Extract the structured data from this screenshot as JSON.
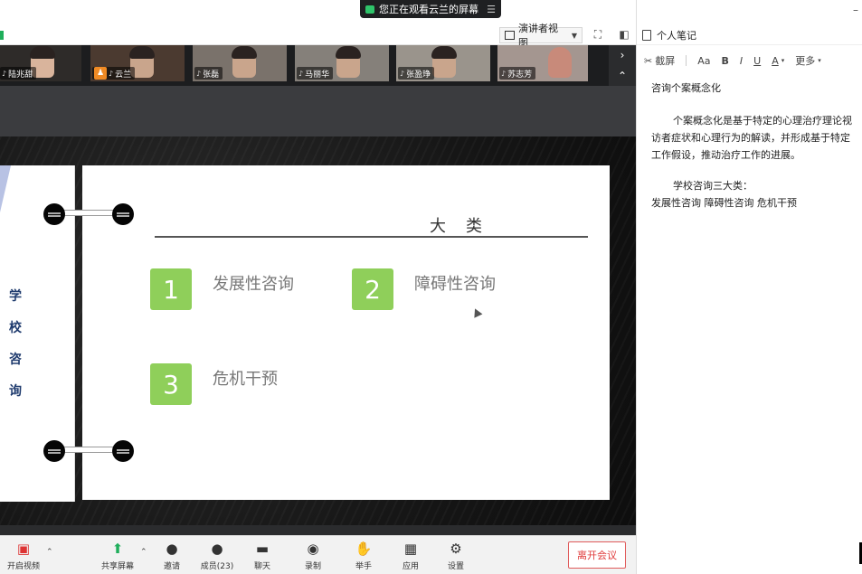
{
  "share_banner": {
    "text": "您正在观看云兰的屏幕",
    "menu_icon": "menu-icon"
  },
  "view_bar": {
    "presenter_view_label": "演讲者视图"
  },
  "participants": [
    {
      "name": "陆兆甜"
    },
    {
      "name": "云兰",
      "is_host": true
    },
    {
      "name": "张磊"
    },
    {
      "name": "马丽华"
    },
    {
      "name": "张盈琤"
    },
    {
      "name": "苏志芳"
    }
  ],
  "slide": {
    "side_title": [
      "学",
      "校",
      "咨",
      "询"
    ],
    "title": "大类",
    "items": [
      {
        "num": "1",
        "label": "发展性咨询"
      },
      {
        "num": "2",
        "label": "障碍性咨询"
      },
      {
        "num": "3",
        "label": "危机干预"
      }
    ],
    "accent_color": "#8fcf5a"
  },
  "toolbar": {
    "video": "开启视频",
    "share": "共享屏幕",
    "invite": "邀请",
    "members": "成员(23)",
    "chat": "聊天",
    "record": "录制",
    "raise_hand": "举手",
    "apps": "应用",
    "settings": "设置",
    "leave": "离开会议"
  },
  "notes": {
    "header": "个人笔记",
    "format": {
      "screenshot": "截屏",
      "font_size": "Aa",
      "bold": "B",
      "italic": "I",
      "underline": "U",
      "color": "A",
      "more": "更多"
    },
    "title": "咨询个案概念化",
    "para1_line1": "个案概念化是基于特定的心理治疗理论视",
    "para1_line2": "访者症状和心理行为的解读，并形成基于特定",
    "para1_line3": "工作假设，推动治疗工作的进展。",
    "heading2": "学校咨询三大类：",
    "list_line": "发展性咨询 障碍性咨询 危机干预"
  }
}
